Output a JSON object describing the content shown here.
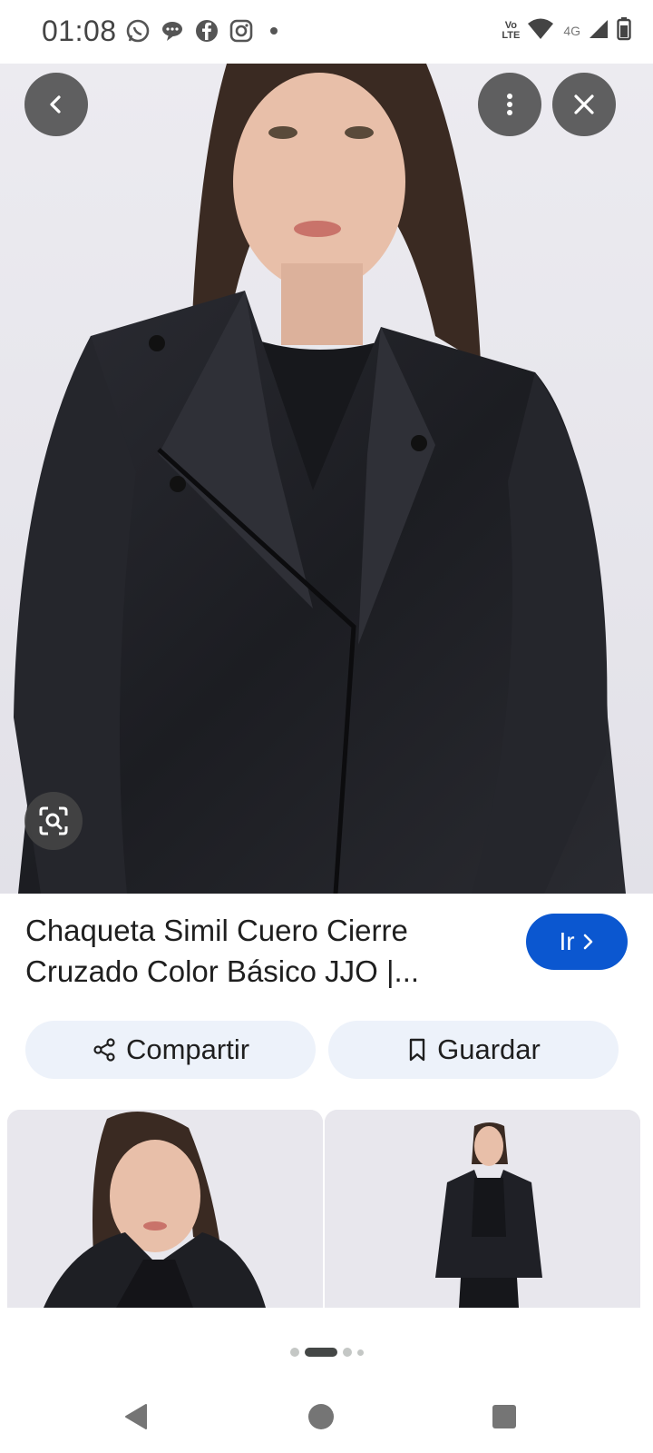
{
  "status_bar": {
    "time": "01:08",
    "notification_icons": [
      "whatsapp-icon",
      "chat-bubble-icon",
      "facebook-icon",
      "instagram-icon"
    ],
    "volte_line1": "Vo",
    "volte_line2": "LTE",
    "network_label": "4G"
  },
  "viewer": {
    "back_label": "Atrás",
    "more_label": "Más opciones",
    "close_label": "Cerrar"
  },
  "result": {
    "title": "Chaqueta Simil Cuero Cierre Cruzado Color Básico JJO |...",
    "go_label": "Ir"
  },
  "actions": {
    "share_label": "Compartir",
    "save_label": "Guardar"
  },
  "pagination": {
    "active_index": 1,
    "total": 4
  },
  "colors": {
    "accent": "#0b57d0",
    "chip_bg": "#edf2fa",
    "overlay_button": "#464646"
  }
}
